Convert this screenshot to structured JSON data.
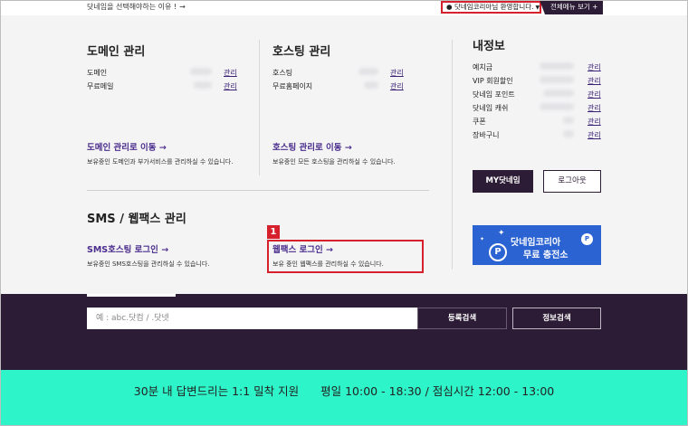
{
  "topbar": {
    "why_text": "닷네임을 선택해야하는 이유 !",
    "why_arrow": "→",
    "welcome": "닷네임코리아님 환영합니다.",
    "welcome_icon": "person-icon",
    "all_menu": "전체메뉴 보기 +"
  },
  "domain": {
    "title": "도메인 관리",
    "rows": [
      {
        "label": "도메인",
        "link": "관리"
      },
      {
        "label": "무료메일",
        "link": "관리"
      }
    ],
    "move_link": "도메인 관리로 이동 →",
    "desc": "보유중인 도메인과 부가서비스를 관리하실 수 있습니다."
  },
  "hosting": {
    "title": "호스팅 관리",
    "rows": [
      {
        "label": "호스팅",
        "link": "관리"
      },
      {
        "label": "무료홈페이지",
        "link": "관리"
      }
    ],
    "move_link": "호스팅 관리로 이동 →",
    "desc": "보유중인 모든 호스팅을 관리하실 수 있습니다."
  },
  "sms": {
    "title": "SMS / 웹팩스 관리",
    "sms_link": "SMS호스팅 로그인 →",
    "sms_desc": "보유중인 SMS호스팅을 관리하실 수 있습니다.",
    "fax_badge": "1",
    "fax_link": "웹팩스 로그인 →",
    "fax_desc": "보유 중인 웹팩스를 관리하실 수 있습니다."
  },
  "myinfo": {
    "title": "내정보",
    "rows": [
      {
        "label": "예치금",
        "link": "관리"
      },
      {
        "label": "VIP 회원할인",
        "link": "관리"
      },
      {
        "label": "닷네임 포인트",
        "link": "관리"
      },
      {
        "label": "닷네임 캐쉬",
        "link": "관리"
      },
      {
        "label": "쿠폰",
        "link": "관리"
      },
      {
        "label": "장바구니",
        "link": "관리"
      }
    ],
    "my_button": "MY닷네임",
    "logout_button": "로그아웃"
  },
  "banner": {
    "line1": "닷네임코리아",
    "line2": "무료 충전소",
    "coin": "P"
  },
  "search": {
    "placeholder": "예 : abc.닷컴 / .닷넷",
    "register_button": "등록검색",
    "info_button": "정보검색"
  },
  "footer": {
    "support": "30분 내 답변드리는 1:1 밀착 지원",
    "hours": "평일 10:00 - 18:30 / 점심시간 12:00 - 13:00"
  },
  "colors": {
    "dark": "#2c1c35",
    "accent_red": "#d6202b",
    "link_purple": "#4a2c8c",
    "footer_mint": "#2ef5c9",
    "banner_blue": "#2c63d2"
  }
}
